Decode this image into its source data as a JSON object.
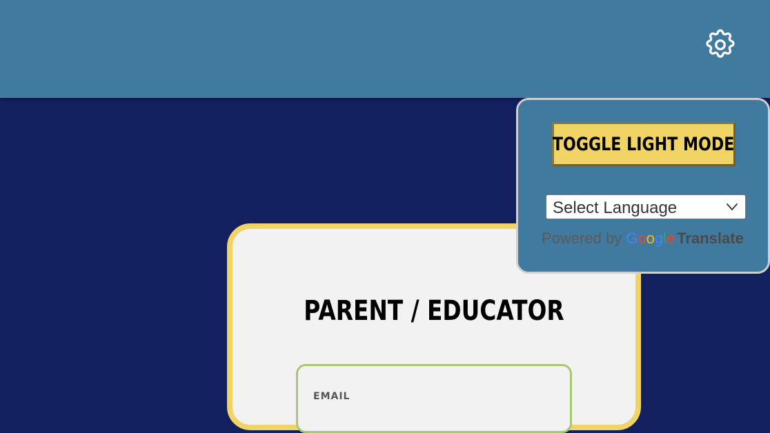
{
  "colors": {
    "page_background": "#12205f",
    "header_background": "#417a9f",
    "accent_yellow": "#f0d466",
    "card_background": "#f2f2f2",
    "email_border": "#a9c576"
  },
  "header": {
    "settings_icon": "gear-icon"
  },
  "settings_popup": {
    "toggle_button_label": "TOGGLE LIGHT MODE",
    "language_select": {
      "selected": "Select Language",
      "icon": "chevron-down-icon"
    },
    "powered_by": {
      "prefix": "Powered by",
      "brand": "Google",
      "product": "Translate"
    }
  },
  "card": {
    "title": "PARENT / EDUCATOR",
    "email_label": "EMAIL"
  }
}
